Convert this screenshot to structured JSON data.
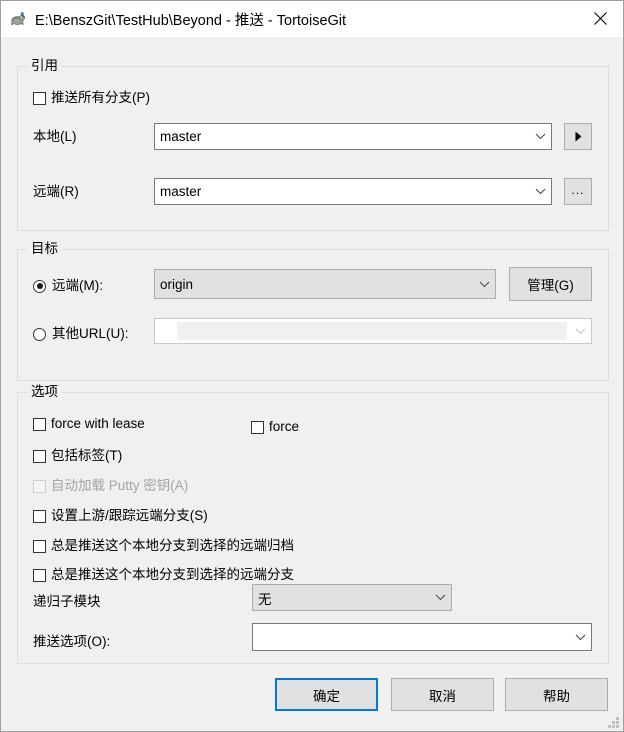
{
  "window": {
    "title": "E:\\BenszGit\\TestHub\\Beyond - 推送 - TortoiseGit",
    "icon": "tortoisegit-turtle-icon",
    "close_label": "✕"
  },
  "ref_group": {
    "legend": "引用",
    "push_all_branches": {
      "label": "推送所有分支(P)",
      "checked": false
    },
    "local": {
      "label": "本地(L)",
      "value": "master"
    },
    "remote": {
      "label": "远端(R)",
      "value": "master"
    },
    "local_arrow_button": "▶",
    "remote_browse_button": "..."
  },
  "dest_group": {
    "legend": "目标",
    "remote_radio": {
      "label": "远端(M):",
      "selected": true,
      "value": "origin"
    },
    "url_radio": {
      "label": "其他URL(U):",
      "selected": false,
      "value": ""
    },
    "manage_button": "管理(G)"
  },
  "options_group": {
    "legend": "选项",
    "force_with_lease": {
      "label": "force with lease",
      "checked": false,
      "disabled": false
    },
    "force": {
      "label": "force",
      "checked": false,
      "disabled": false
    },
    "include_tags": {
      "label": "包括标签(T)",
      "checked": false,
      "disabled": false
    },
    "autoload_putty_key": {
      "label": "自动加载 Putty 密钥(A)",
      "checked": false,
      "disabled": true
    },
    "set_upstream": {
      "label": "设置上游/跟踪远端分支(S)",
      "checked": false,
      "disabled": false
    },
    "always_push_to_remote_archive": {
      "label": "总是推送这个本地分支到选择的远端归档",
      "checked": false,
      "disabled": false
    },
    "always_push_to_remote_branch": {
      "label": "总是推送这个本地分支到选择的远端分支",
      "checked": false,
      "disabled": false
    },
    "recurse_submodules": {
      "label": "递归子模块",
      "value": "无"
    },
    "push_options": {
      "label": "推送选项(O):",
      "value": ""
    }
  },
  "buttons": {
    "ok": "确定",
    "cancel": "取消",
    "help": "帮助"
  },
  "colors": {
    "accent": "#0078d7",
    "dialog_bg": "#f0f0f0",
    "titlebar_bg": "#ffffff",
    "disabled_text": "#a3a3a3"
  }
}
